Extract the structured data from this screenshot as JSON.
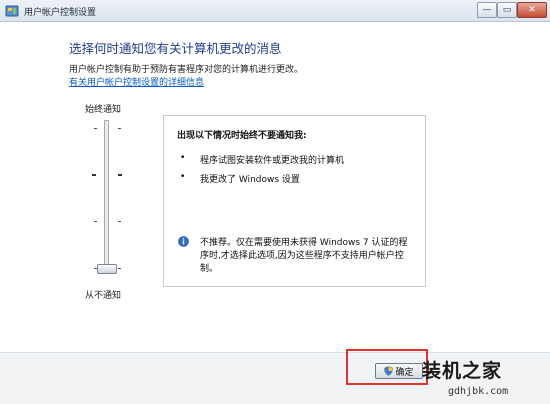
{
  "window": {
    "title": "用户帐户控制设置",
    "minimize_glyph": "—",
    "maximize_glyph": "▭",
    "close_glyph": "✕"
  },
  "main": {
    "heading": "选择何时通知您有关计算机更改的消息",
    "description": "用户帐户控制有助于预防有害程序对您的计算机进行更改。",
    "more_link": "有关用户帐户控制设置的详细信息"
  },
  "slider": {
    "top_label": "始终通知",
    "bottom_label": "从不通知",
    "levels": 4,
    "current_level": 1
  },
  "info_panel": {
    "title": "出现以下情况时始终不要通知我:",
    "bullets": [
      "程序试图安装软件或更改我的计算机",
      "我更改了 Windows 设置"
    ],
    "bullet_glyph": "•",
    "note": "不推荐。仅在需要使用未获得 Windows 7 认证的程序时,才选择此选项,因为这些程序不支持用户帐户控制。"
  },
  "footer": {
    "ok_label": "确定"
  },
  "watermark": {
    "title": "装机之家",
    "url": "gdhjbk.com"
  },
  "colors": {
    "heading": "#1f3f91",
    "link": "#0b5bc7",
    "highlight": "#e0352c",
    "info_icon": "#2f6fc9"
  },
  "icons": {
    "title": "shield-icon",
    "info": "info-icon",
    "ok": "uac-shield-icon"
  }
}
